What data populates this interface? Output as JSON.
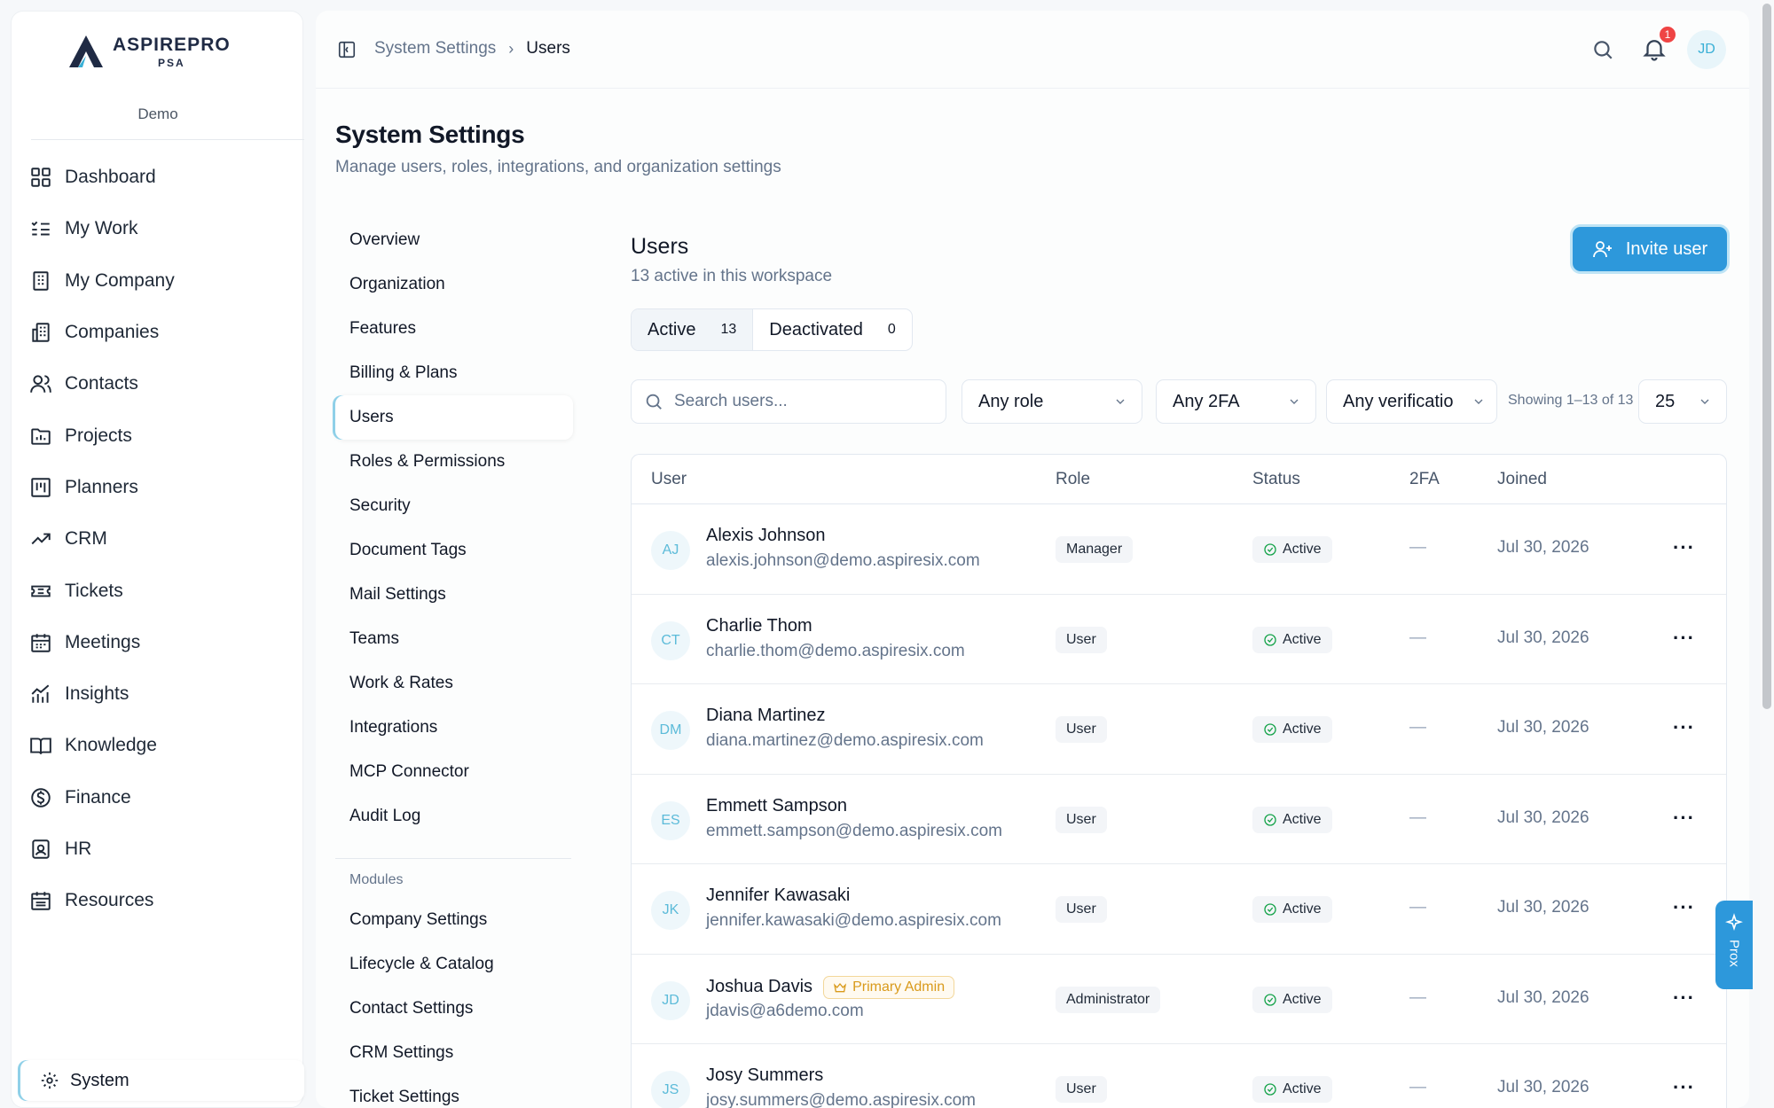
{
  "brand": {
    "name": "ASPIREPRO",
    "sub": "PSA",
    "workspace": "Demo"
  },
  "sidebar": {
    "items": [
      {
        "label": "Dashboard",
        "icon": "grid-icon"
      },
      {
        "label": "My Work",
        "icon": "list-check-icon"
      },
      {
        "label": "My Company",
        "icon": "building-icon"
      },
      {
        "label": "Companies",
        "icon": "buildings-icon"
      },
      {
        "label": "Contacts",
        "icon": "users-icon"
      },
      {
        "label": "Projects",
        "icon": "folder-chart-icon"
      },
      {
        "label": "Planners",
        "icon": "kanban-icon"
      },
      {
        "label": "CRM",
        "icon": "trend-up-icon"
      },
      {
        "label": "Tickets",
        "icon": "ticket-icon"
      },
      {
        "label": "Meetings",
        "icon": "calendar-icon"
      },
      {
        "label": "Insights",
        "icon": "bar-chart-icon"
      },
      {
        "label": "Knowledge",
        "icon": "book-icon"
      },
      {
        "label": "Finance",
        "icon": "dollar-circle-icon"
      },
      {
        "label": "HR",
        "icon": "id-badge-icon"
      },
      {
        "label": "Resources",
        "icon": "calendar-grid-icon"
      }
    ],
    "system_label": "System"
  },
  "topbar": {
    "breadcrumb": [
      "System Settings",
      "Users"
    ],
    "notification_count": "1",
    "avatar_initials": "JD"
  },
  "page": {
    "title": "System Settings",
    "subtitle": "Manage users, roles, integrations, and organization settings"
  },
  "settings_nav": {
    "items": [
      "Overview",
      "Organization",
      "Features",
      "Billing & Plans",
      "Users",
      "Roles & Permissions",
      "Security",
      "Document Tags",
      "Mail Settings",
      "Teams",
      "Work & Rates",
      "Integrations",
      "MCP Connector",
      "Audit Log"
    ],
    "active": "Users",
    "modules_label": "Modules",
    "modules": [
      "Company Settings",
      "Lifecycle & Catalog",
      "Contact Settings",
      "CRM Settings",
      "Ticket Settings"
    ]
  },
  "users": {
    "title": "Users",
    "subtitle": "13 active in this workspace",
    "invite_label": "Invite user",
    "tabs": [
      {
        "label": "Active",
        "count": "13"
      },
      {
        "label": "Deactivated",
        "count": "0"
      }
    ],
    "search_placeholder": "Search users...",
    "filters": {
      "role": "Any role",
      "twofa": "Any 2FA",
      "verification": "Any verificatio",
      "page_size": "25"
    },
    "showing": "Showing 1–13 of 13",
    "columns": [
      "User",
      "Role",
      "Status",
      "2FA",
      "Joined"
    ],
    "rows": [
      {
        "initials": "AJ",
        "name": "Alexis Johnson",
        "email": "alexis.johnson@demo.aspiresix.com",
        "role": "Manager",
        "status": "Active",
        "twofa": "—",
        "joined": "Jul 30, 2026",
        "badge": ""
      },
      {
        "initials": "CT",
        "name": "Charlie Thom",
        "email": "charlie.thom@demo.aspiresix.com",
        "role": "User",
        "status": "Active",
        "twofa": "—",
        "joined": "Jul 30, 2026",
        "badge": ""
      },
      {
        "initials": "DM",
        "name": "Diana Martinez",
        "email": "diana.martinez@demo.aspiresix.com",
        "role": "User",
        "status": "Active",
        "twofa": "—",
        "joined": "Jul 30, 2026",
        "badge": ""
      },
      {
        "initials": "ES",
        "name": "Emmett Sampson",
        "email": "emmett.sampson@demo.aspiresix.com",
        "role": "User",
        "status": "Active",
        "twofa": "—",
        "joined": "Jul 30, 2026",
        "badge": ""
      },
      {
        "initials": "JK",
        "name": "Jennifer Kawasaki",
        "email": "jennifer.kawasaki@demo.aspiresix.com",
        "role": "User",
        "status": "Active",
        "twofa": "—",
        "joined": "Jul 30, 2026",
        "badge": ""
      },
      {
        "initials": "JD",
        "name": "Joshua Davis",
        "email": "jdavis@a6demo.com",
        "role": "Administrator",
        "status": "Active",
        "twofa": "—",
        "joined": "Jul 30, 2026",
        "badge": "Primary Admin"
      },
      {
        "initials": "JS",
        "name": "Josy Summers",
        "email": "josy.summers@demo.aspiresix.com",
        "role": "User",
        "status": "Active",
        "twofa": "—",
        "joined": "Jul 30, 2026",
        "badge": ""
      }
    ],
    "more_label": "···"
  },
  "assistant": {
    "label": "Prox"
  },
  "colors": {
    "accent": "#2d98db",
    "active_indicator": "#8fd0e8",
    "success": "#16a34a",
    "admin_badge": "#d99a1b",
    "notification": "#ef4444"
  }
}
